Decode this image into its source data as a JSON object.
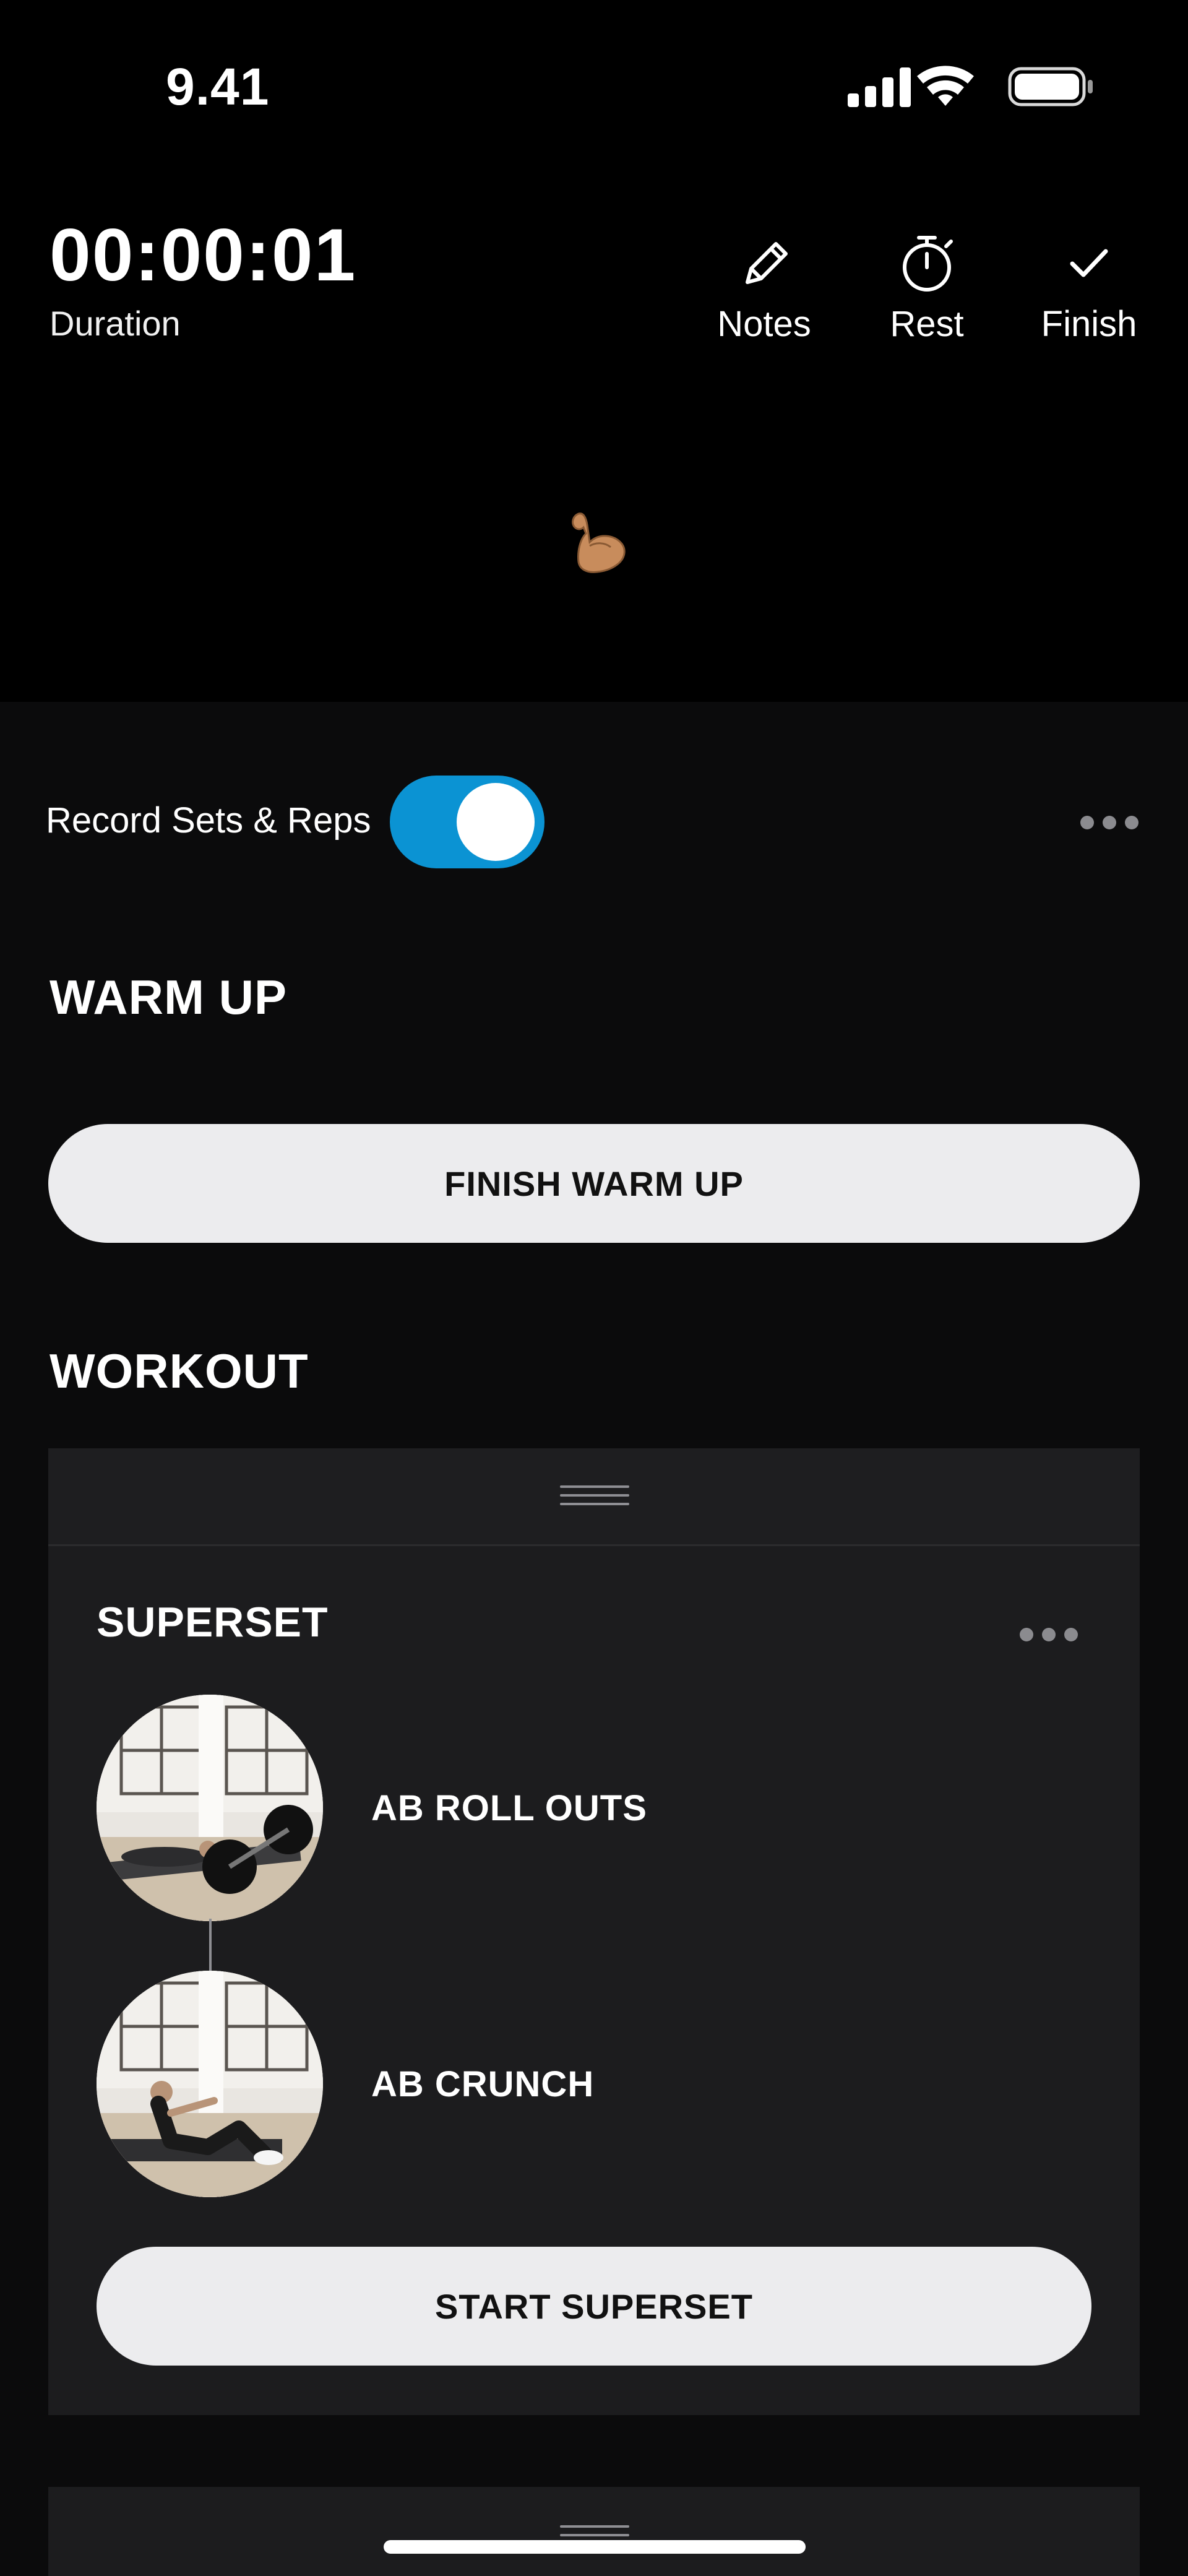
{
  "status_bar": {
    "time": "9.41",
    "icons": [
      "signal-icon",
      "wifi-icon",
      "battery-icon"
    ]
  },
  "timer": {
    "value": "00:00:01",
    "label": "Duration"
  },
  "actions": [
    {
      "label": "Notes",
      "icon": "pencil-icon"
    },
    {
      "label": "Rest",
      "icon": "stopwatch-icon"
    },
    {
      "label": "Finish",
      "icon": "checkmark-icon"
    }
  ],
  "record": {
    "label": "Record Sets & Reps",
    "enabled": true
  },
  "warm_up": {
    "title": "WARM UP",
    "button": "FINISH WARM UP"
  },
  "workout": {
    "title": "WORKOUT",
    "superset": {
      "title": "SUPERSET",
      "exercises": [
        {
          "name": "AB ROLL OUTS"
        },
        {
          "name": "AB CRUNCH"
        }
      ],
      "button": "START SUPERSET"
    }
  },
  "colors": {
    "accent": "#0b93d3",
    "background": "#0b0b0c",
    "card": "#1c1c1e",
    "button": "#ececee"
  }
}
